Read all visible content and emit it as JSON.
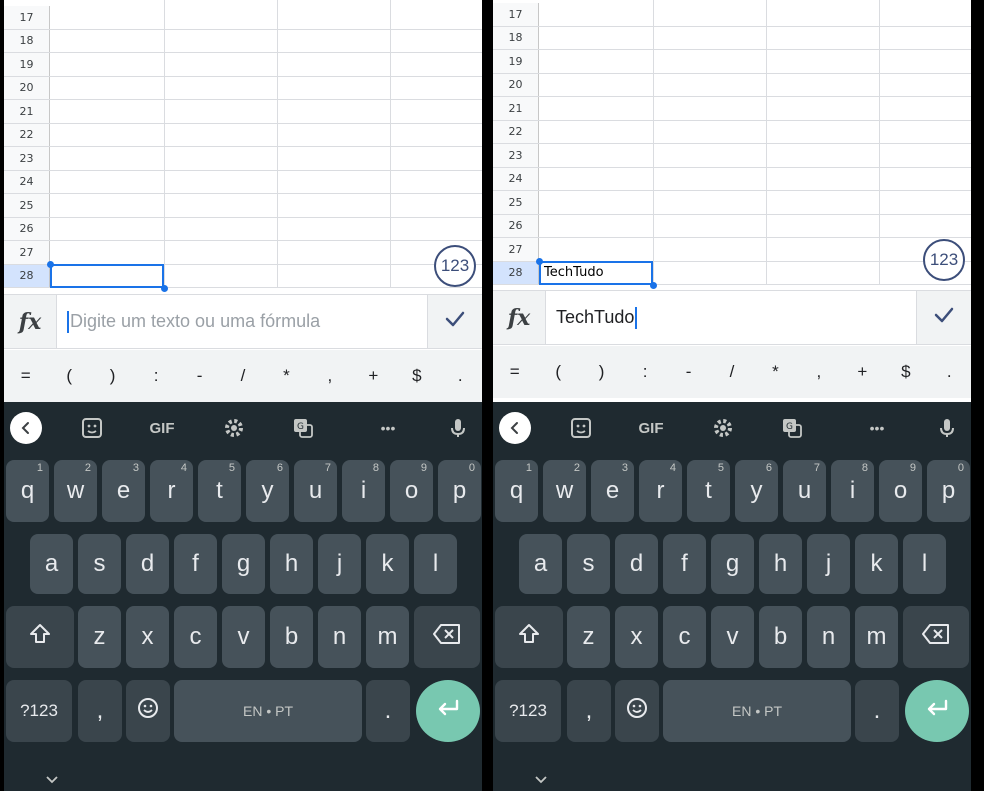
{
  "panels": [
    {
      "id": "left",
      "rows": [
        "17",
        "18",
        "19",
        "20",
        "21",
        "22",
        "23",
        "24",
        "25",
        "26",
        "27",
        "28"
      ],
      "active_row": "28",
      "cell_value": "",
      "fab_label": "123",
      "formula_placeholder": "Digite um texto ou uma fórmula",
      "formula_value": ""
    },
    {
      "id": "right",
      "rows": [
        "17",
        "18",
        "19",
        "20",
        "21",
        "22",
        "23",
        "24",
        "25",
        "26",
        "27",
        "28"
      ],
      "active_row": "28",
      "cell_value": "TechTudo",
      "fab_label": "123",
      "formula_placeholder": "",
      "formula_value": "TechTudo"
    }
  ],
  "formula_bar": {
    "fx_label": "fx",
    "confirm_icon": "checkmark-icon"
  },
  "symbols": [
    "=",
    "(",
    ")",
    ":",
    "-",
    "/",
    "*",
    ",",
    "+",
    "$",
    "."
  ],
  "keyboard": {
    "toolbar_icons": [
      "back-icon",
      "sticker-icon",
      "gif-icon",
      "settings-icon",
      "translate-icon",
      "more-icon",
      "mic-icon"
    ],
    "gif_label": "GIF",
    "more_label": "•••",
    "row1": [
      {
        "key": "q",
        "hint": "1"
      },
      {
        "key": "w",
        "hint": "2"
      },
      {
        "key": "e",
        "hint": "3"
      },
      {
        "key": "r",
        "hint": "4"
      },
      {
        "key": "t",
        "hint": "5"
      },
      {
        "key": "y",
        "hint": "6"
      },
      {
        "key": "u",
        "hint": "7"
      },
      {
        "key": "i",
        "hint": "8"
      },
      {
        "key": "o",
        "hint": "9"
      },
      {
        "key": "p",
        "hint": "0"
      }
    ],
    "row2": [
      "a",
      "s",
      "d",
      "f",
      "g",
      "h",
      "j",
      "k",
      "l"
    ],
    "row3": [
      "z",
      "x",
      "c",
      "v",
      "b",
      "n",
      "m"
    ],
    "symbols_key": "?123",
    "comma_key": ",",
    "space_label": "EN • PT",
    "period_key": ".",
    "accent_color": "#78c8b0",
    "background_color": "#1f2a30"
  }
}
